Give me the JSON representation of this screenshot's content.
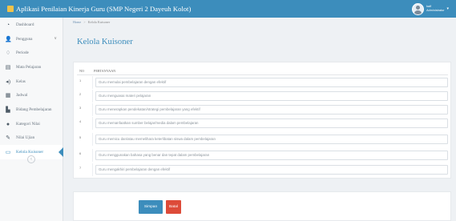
{
  "app": {
    "title": "Aplikasi Penilaian Kinerja Guru (SMP Negeri 2 Dayeuh Kolot)",
    "user_name": "kaif",
    "user_role": "Administrator"
  },
  "sidebar": {
    "items": [
      {
        "label": "Dashboard",
        "icon": "dashboard-icon",
        "glyph": "◔"
      },
      {
        "label": "Pengguna",
        "icon": "user-icon",
        "glyph": "👤"
      },
      {
        "label": "Periode",
        "icon": "bell-icon",
        "glyph": "♢"
      },
      {
        "label": "Mata Pelajaran",
        "icon": "book-icon",
        "glyph": "▤"
      },
      {
        "label": "Kelas",
        "icon": "bullhorn-icon",
        "glyph": "◂)"
      },
      {
        "label": "Jadwal",
        "icon": "calendar-icon",
        "glyph": "▦"
      },
      {
        "label": "Bidang Pembelajaran",
        "icon": "file-icon",
        "glyph": "▙"
      },
      {
        "label": "Kategori Nilai",
        "icon": "circle-icon",
        "glyph": "●"
      },
      {
        "label": "Nilai Ujian",
        "icon": "edit-icon",
        "glyph": "✎"
      },
      {
        "label": "Kelola Kuisoner",
        "icon": "list-icon",
        "glyph": "▭"
      }
    ],
    "pengguna_chevron": "∨",
    "collapse_glyph": "‹"
  },
  "breadcrumb": {
    "home": "Home",
    "sep": ">",
    "current": "Kelola Kuisoner"
  },
  "page_title": "Kelola Kuisoner",
  "table": {
    "col_no": "NO",
    "col_question": "PERTANYAAN",
    "rows": [
      {
        "no": "1",
        "text": "Guru memulai pembelajaran dengan efektif"
      },
      {
        "no": "2",
        "text": "Guru menguasai materi pelajaran"
      },
      {
        "no": "3",
        "text": "Guru menerapkan pendekatan/strategi pembelajaran yang efektif"
      },
      {
        "no": "4",
        "text": "Guru memanfaatkan sumber belajar/media dalam pembelajaran"
      },
      {
        "no": "5",
        "text": "Guru memicu dan/atau memelihara keterlibatan siswa dalam pembelajaran"
      },
      {
        "no": "6",
        "text": "Guru menggunakan bahasa yang benar dan tepat dalam pembelajaran"
      },
      {
        "no": "7",
        "text": "Guru mengakhiri pembelajaran dengan efektif"
      }
    ]
  },
  "actions": {
    "save_label": "Simpan",
    "cancel_label": "Batal"
  },
  "colors": {
    "primary": "#3c8dbc",
    "danger": "#dd4b39"
  }
}
